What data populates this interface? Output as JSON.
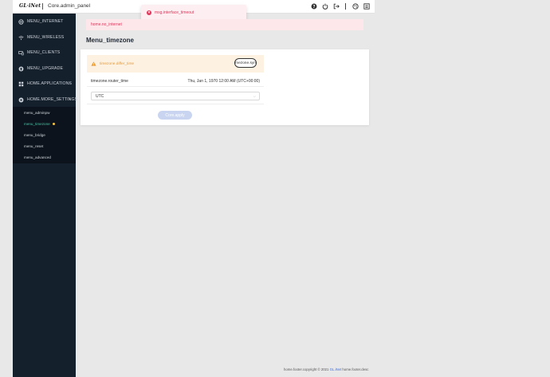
{
  "topbar": {
    "logo_text": "GL·iNet",
    "title": "Core.admin_panel",
    "icons": [
      "help-circle-icon",
      "power-icon",
      "logout-icon",
      "theme-icon",
      "language-icon"
    ]
  },
  "toast": {
    "icon": "error-circle-icon",
    "message": "msg.interface_timeout"
  },
  "sidebar": {
    "items": [
      {
        "icon": "globe-icon",
        "label": "MENU_INTERNET"
      },
      {
        "icon": "wifi-icon",
        "label": "MENU_WIRELESS"
      },
      {
        "icon": "clients-icon",
        "label": "MENU_CLIENTS"
      },
      {
        "icon": "upgrade-icon",
        "label": "MENU_UPGRADE"
      },
      {
        "icon": "apps-grid-icon",
        "label": "HOME.APPLICATIONS",
        "arrow": "›"
      },
      {
        "icon": "settings-icon",
        "label": "HOME.MORE_SETTINGS",
        "arrow": "›"
      }
    ],
    "submenu": [
      {
        "label": "menu_adminpw"
      },
      {
        "label": "menu_timezone",
        "active": true
      },
      {
        "label": "menu_bridge"
      },
      {
        "label": "menu_reset"
      },
      {
        "label": "menu_advanced"
      }
    ]
  },
  "alert": {
    "message": "home.no_internet"
  },
  "page": {
    "title": "Menu_timezone"
  },
  "card": {
    "warning_text": "timezone.differ_time",
    "sync_button": "timezone.sync",
    "time_label": "timezone.router_time",
    "time_value": "Thu, Jan 1, 1970 12:00 AM (UTC+00:00)",
    "timezone_selected": "UTC",
    "apply_button": "Core.apply"
  },
  "footer": {
    "prefix": "home.footer.copyright © 2021",
    "brand": "GL.iNet",
    "suffix": "home.footer.desc"
  },
  "colors": {
    "sidebar_bg": "#15202d",
    "active_menu": "#4cc1a3",
    "error": "#e0345a",
    "warning": "#e99a32",
    "apply_disabled": "#c9d5f0"
  }
}
